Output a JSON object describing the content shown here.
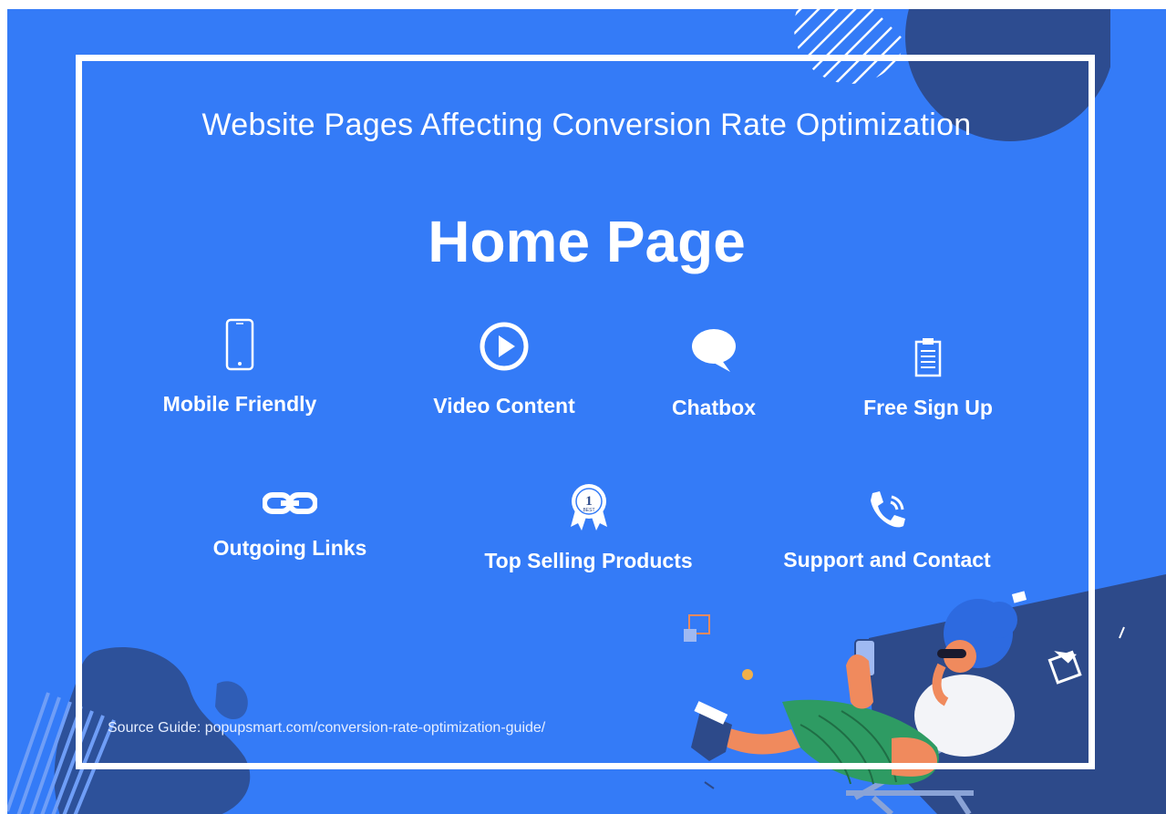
{
  "header": {
    "subtitle": "Website Pages Affecting  Conversion Rate Optimization",
    "title": "Home Page"
  },
  "features_row1": [
    {
      "label": "Mobile Friendly",
      "icon": "mobile-phone-icon"
    },
    {
      "label": "Video Content",
      "icon": "play-circle-icon"
    },
    {
      "label": "Chatbox",
      "icon": "chat-bubble-icon"
    },
    {
      "label": "Free Sign Up",
      "icon": "clipboard-icon"
    }
  ],
  "features_row2": [
    {
      "label": "Outgoing Links",
      "icon": "link-icon"
    },
    {
      "label": "Top Selling Products",
      "icon": "best-ribbon-icon"
    },
    {
      "label": "Support and Contact",
      "icon": "phone-icon"
    }
  ],
  "badge": {
    "number": "1",
    "text": "BEST"
  },
  "footer": {
    "source": "Source Guide: popupsmart.com/conversion-rate-optimization-guide/"
  },
  "colors": {
    "background": "#347bf7",
    "dark_shape": "#2d4a8a",
    "frame": "#ffffff",
    "accent_green": "#2e9b63",
    "accent_orange": "#f08a5d"
  }
}
